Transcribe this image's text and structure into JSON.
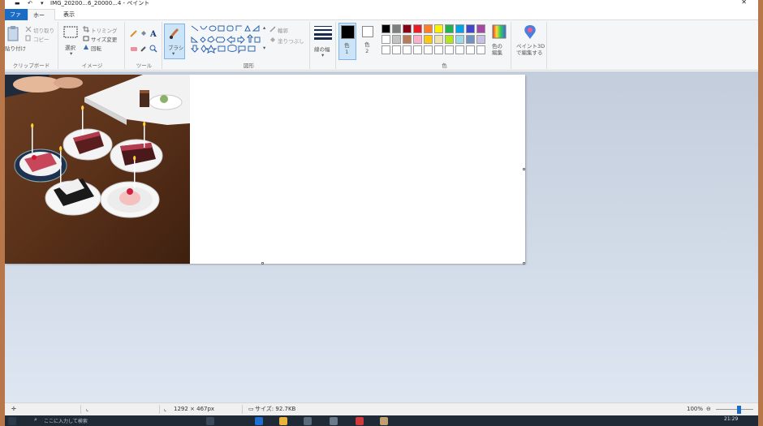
{
  "titlebar": {
    "title": "IMG_20200...6_20000...4 - ペイント",
    "close_glyph": "✕"
  },
  "tabs": {
    "file": "ファイル",
    "home": "ホーム",
    "view": "表示"
  },
  "ribbon": {
    "clipboard": {
      "paste": "貼り付け",
      "cut": "切り取り",
      "copy": "コピー",
      "group": "クリップボード"
    },
    "image": {
      "select": "選択",
      "crop": "トリミング",
      "resize": "サイズ変更",
      "rotate": "回転",
      "group": "イメージ"
    },
    "tools": {
      "group": "ツール"
    },
    "brushes": {
      "label": "ブラシ"
    },
    "shapes": {
      "outline": "輪郭",
      "fill": "塗りつぶし",
      "group": "図形"
    },
    "size": {
      "label": "線の幅"
    },
    "colors": {
      "color1": "色\n1",
      "color2": "色\n2",
      "edit": "色の\n編集",
      "group": "色",
      "palette_row1": [
        "#000000",
        "#7f7f7f",
        "#880015",
        "#ed1c24",
        "#ff7f27",
        "#fff200",
        "#22b14c",
        "#00a2e8",
        "#3f48cc",
        "#a349a4"
      ],
      "palette_row2": [
        "#ffffff",
        "#c3c3c3",
        "#b97a57",
        "#ffaec9",
        "#ffc90e",
        "#efe4b0",
        "#b5e61d",
        "#99d9ea",
        "#7092be",
        "#c8bfe7"
      ],
      "palette_row3": [
        "#ffffff",
        "#ffffff",
        "#ffffff",
        "#ffffff",
        "#ffffff",
        "#ffffff",
        "#ffffff",
        "#ffffff",
        "#ffffff",
        "#ffffff"
      ]
    },
    "paint3d": {
      "label": "ペイント3D\nで編集する"
    }
  },
  "statusbar": {
    "dimensions": "1292 × 467px",
    "size": "サイズ: 92.7KB",
    "zoom": "100%"
  },
  "taskbar": {
    "search": "ここに入力して検索",
    "clock": "21:29"
  }
}
